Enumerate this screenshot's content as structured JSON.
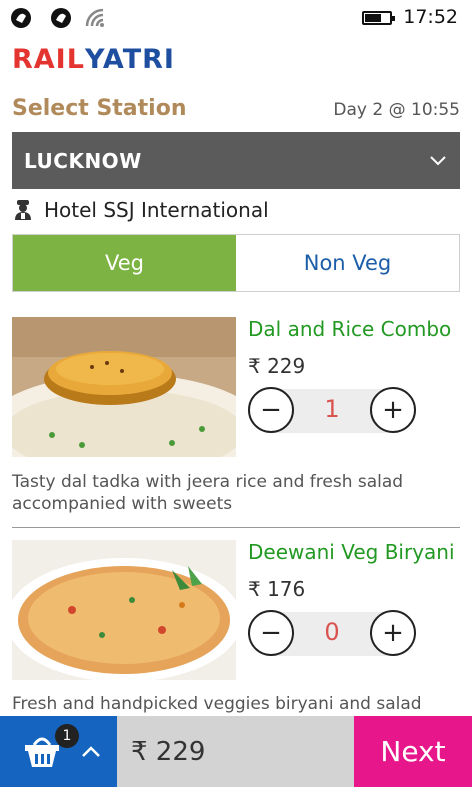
{
  "status_bar": {
    "time": "17:52",
    "icons": [
      "notification-icon",
      "notification-icon",
      "wifi-icon",
      "battery-icon"
    ]
  },
  "logo": {
    "part1": "RAIL",
    "part2": "YATRI"
  },
  "header": {
    "title": "Select Station",
    "day_time": "Day 2 @ 10:55"
  },
  "station": {
    "selected": "LUCKNOW"
  },
  "hotel": {
    "name": "Hotel SSJ International"
  },
  "filter": {
    "veg_label": "Veg",
    "nonveg_label": "Non Veg",
    "active": "Veg"
  },
  "items": [
    {
      "title": "Dal  and  Rice Combo",
      "price": "₹ 229",
      "qty_minus": "−",
      "qty_plus": "+",
      "quantity": "1",
      "description": "Tasty dal tadka with jeera rice and fresh salad accompanied with sweets"
    },
    {
      "title": "Deewani Veg Biryani",
      "price": "₹ 176",
      "qty_minus": "−",
      "qty_plus": "+",
      "quantity": "0",
      "description": "Fresh and handpicked veggies biryani and salad with"
    }
  ],
  "cart": {
    "count": "1",
    "total": "₹ 229",
    "next_label": "Next"
  },
  "colors": {
    "veg_green": "#7cb342",
    "dropdown_gray": "#5b5b5b",
    "cart_blue": "#1565c0",
    "next_pink": "#e7168a",
    "title_green": "#229922",
    "header_tan": "#b08a5a"
  }
}
